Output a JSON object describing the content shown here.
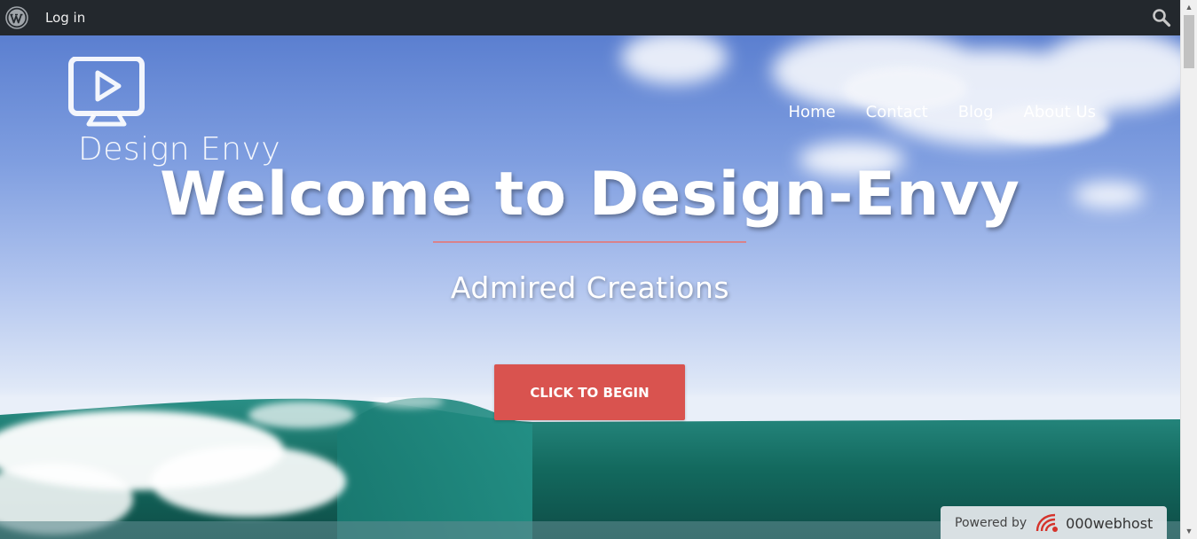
{
  "adminbar": {
    "login_label": "Log in",
    "wp_logo_icon": "wordpress-logo-icon",
    "search_icon": "search-icon"
  },
  "site": {
    "logo_icon": "monitor-play-icon",
    "logo_text": "Design Envy"
  },
  "nav": {
    "items": [
      {
        "label": "Home"
      },
      {
        "label": "Contact"
      },
      {
        "label": "Blog"
      },
      {
        "label": "About Us"
      }
    ]
  },
  "hero": {
    "headline": "Welcome to Design-Envy",
    "subheadline": "Admired Creations",
    "cta_label": "CLICK TO BEGIN",
    "accent_color": "#d9534f"
  },
  "badge": {
    "powered_label": "Powered by",
    "host_icon": "000webhost-logo-icon",
    "host_label": "000webhost"
  }
}
